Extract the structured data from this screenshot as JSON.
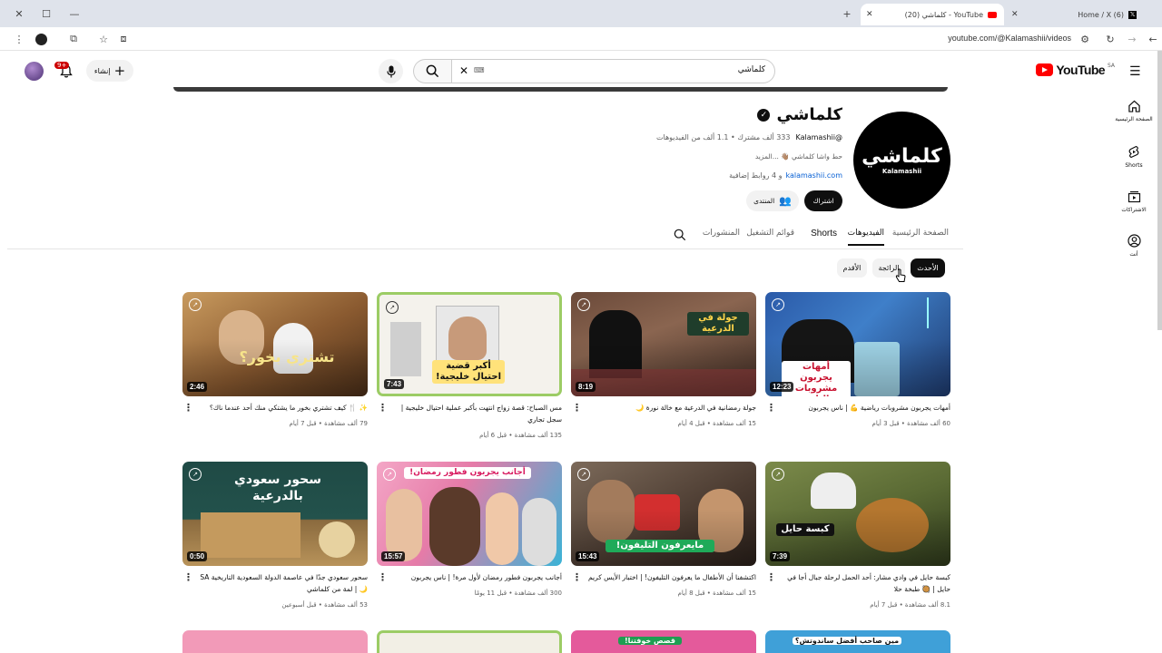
{
  "browser": {
    "tabs": [
      {
        "title": "YouTube - كلماشي (20)",
        "active": true
      },
      {
        "title": "(6) Home / X",
        "active": false
      }
    ],
    "url": "youtube.com/@Kalamashii/videos"
  },
  "header": {
    "logo_text": "YouTube",
    "country_code": "SA",
    "search_value": "كلماشي",
    "create_label": "إنشاء",
    "notification_count": "9+"
  },
  "sidebar": {
    "items": [
      {
        "label": "الصفحة الرئيسية",
        "icon": "home-icon"
      },
      {
        "label": "Shorts",
        "icon": "shorts-icon"
      },
      {
        "label": "الاشتراكات",
        "icon": "subscriptions-icon"
      },
      {
        "label": "أنت",
        "icon": "you-icon"
      }
    ]
  },
  "channel": {
    "name": "كلماشي",
    "avatar_text": "كلماشي",
    "avatar_subtext": "Kalamashii",
    "handle": "@Kalamashii",
    "stats": "333 ألف مشترك • 1.1 ألف من الفيديوهات",
    "description": "حط واشا كلماشي 👋🏽 ...المزيد",
    "link": "kalamashii.com",
    "link_suffix": "و 4 روابط إضافية",
    "subscribe_label": "اشتراك",
    "community_label": "المنتدى"
  },
  "tabs": [
    "الصفحة الرئيسية",
    "الفيديوهات",
    "Shorts",
    "قوائم التشغيل",
    "المنشورات"
  ],
  "selected_tab": "الفيديوهات",
  "chips": [
    "الأحدث",
    "الرائجة",
    "الأقدم"
  ],
  "selected_chip": "الأحدث",
  "videos": [
    {
      "title": "أمهات يجربون مشروبات رياضية 💪 | ناس يجربون",
      "meta1": "60 ألف مشاهدة • قبل 3 أيام",
      "meta2": "",
      "duration": "12:23",
      "thumb_text": "أمهات يجربون مشروبات الناس"
    },
    {
      "title": "جولة رمضانية في الدرعية مع خالة نورة 🌙",
      "meta1": "15 ألف مشاهدة • قبل 4 أيام",
      "meta2": "",
      "duration": "8:19",
      "thumb_text": "جولة في الدرعية"
    },
    {
      "title": "مس الصباح: قصة زواج انتهت بأكبر عملية احتيال خليجية | سجل تجاري",
      "meta1": "135 ألف مشاهدة • قبل 6 أيام",
      "meta2": "",
      "duration": "7:43",
      "thumb_text": "أكبر قضية احتيال خليجية!"
    },
    {
      "title": "✨ 🍴 كيف تشتري بخور ما يشتكي منك أحد عندما ناك؟",
      "meta1": "79 ألف مشاهدة • قبل 7 أيام",
      "meta2": "",
      "duration": "2:46",
      "thumb_text": "تشتري بخور؟"
    },
    {
      "title": "كبسة حايل في وادي مشار: أحد الحمل لرحلة جبال أجا في حايل | 🥘 طبخة حلا",
      "meta1": "8.1 ألف مشاهدة • قبل 7 أيام",
      "meta2": "",
      "duration": "7:39",
      "thumb_text": "كبسة حايل"
    },
    {
      "title": "اكتشفنا أن الأطفال ما يعرفون التليفون! | اختبار الأيس كريم",
      "meta1": "15 ألف مشاهدة • قبل 8 أيام",
      "meta2": "",
      "duration": "15:43",
      "thumb_text": "مايعرفون التليفون!"
    },
    {
      "title": "أجانب يجربون فطور رمضان لأول مرة! | ناس يجربون",
      "meta1": "300 ألف مشاهدة • قبل 11 يومًا",
      "meta2": "",
      "duration": "15:57",
      "thumb_text": "أجانب يجربون فطور رمضان!"
    },
    {
      "title": "سحور سعودي جدًا في عاصمة الدولة السعودية التاريخية SA 🌙 | لمة من كلماشي",
      "meta1": "53 ألف مشاهدة • قبل أسبوعين",
      "meta2": "",
      "duration": "0:50",
      "thumb_text": "سحور سعودي بالدرعية"
    }
  ],
  "partial_row_texts": [
    "مين صاحب أفضل ساندوتش؟",
    "قصص خوفتنا!",
    "",
    ""
  ],
  "colors": {
    "accent_red": "#ff0000",
    "subscribe_bg": "#0f0f0f",
    "chip_selected": "#0f0f0f"
  }
}
